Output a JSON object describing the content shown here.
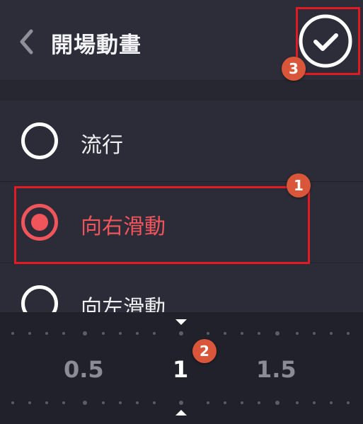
{
  "header": {
    "title": "開場動畫",
    "back_icon": "chevron-left-icon",
    "confirm_icon": "checkmark-circle-icon"
  },
  "options": [
    {
      "label": "流行",
      "selected": false
    },
    {
      "label": "向右滑動",
      "selected": true
    },
    {
      "label": "向左滑動",
      "selected": false
    }
  ],
  "ruler": {
    "ticks": [
      "0.5",
      "1",
      "1.5"
    ],
    "current": "1"
  },
  "annotations": {
    "badge1": "1",
    "badge2": "2",
    "badge3": "3"
  },
  "colors": {
    "accent": "#f0555c",
    "annotation": "#e01b24",
    "badge": "#d9563a",
    "background": "#2a2b36"
  }
}
